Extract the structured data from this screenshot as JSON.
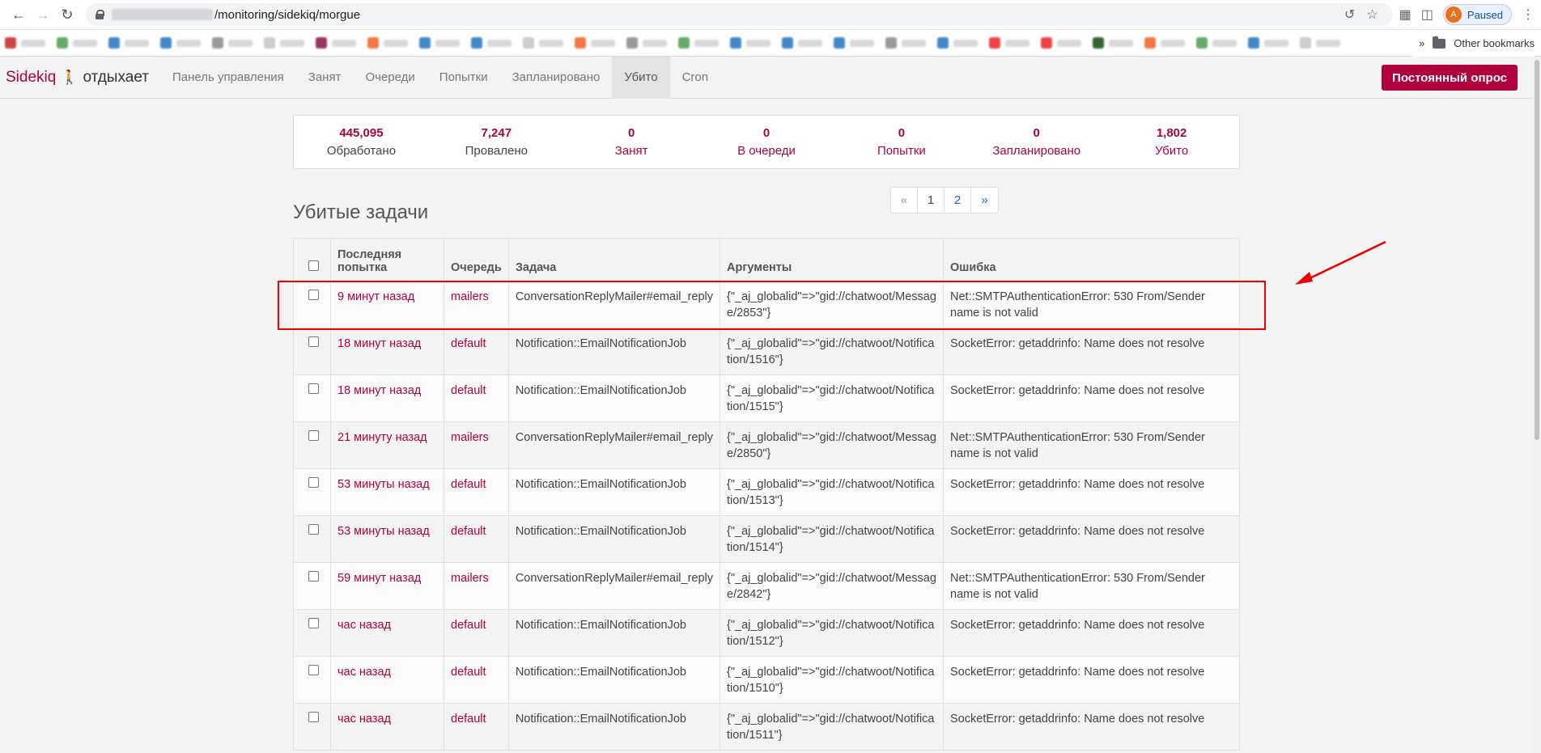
{
  "browser": {
    "url_path": "/monitoring/sidekiq/morgue",
    "profile_initial": "A",
    "profile_status": "Paused",
    "other_bookmarks": "Other bookmarks",
    "bookmarks_overflow": "»"
  },
  "navbar": {
    "brand_name": "Sidekiq",
    "brand_status": "отдыхает",
    "items": [
      {
        "label": "Панель управления"
      },
      {
        "label": "Занят"
      },
      {
        "label": "Очереди"
      },
      {
        "label": "Попытки"
      },
      {
        "label": "Запланировано"
      },
      {
        "label": "Убито",
        "active": true
      },
      {
        "label": "Cron"
      }
    ],
    "poll_button": "Постоянный опрос"
  },
  "summary": [
    {
      "value": "445,095",
      "label": "Обработано"
    },
    {
      "value": "7,247",
      "label": "Провалено"
    },
    {
      "value": "0",
      "label": "Занят"
    },
    {
      "value": "0",
      "label": "В очереди"
    },
    {
      "value": "0",
      "label": "Попытки"
    },
    {
      "value": "0",
      "label": "Запланировано"
    },
    {
      "value": "1,802",
      "label": "Убито"
    }
  ],
  "page_title": "Убитые задачи",
  "pagination": {
    "prev": "«",
    "pages": [
      "1",
      "2"
    ],
    "next": "»",
    "current": "1"
  },
  "table": {
    "headers": [
      "Последняя попытка",
      "Очередь",
      "Задача",
      "Аргументы",
      "Ошибка"
    ],
    "rows": [
      {
        "time": "9 минут назад",
        "queue": "mailers",
        "job": "ConversationReplyMailer#email_reply",
        "args": "{\"_aj_globalid\"=>\"gid://chatwoot/Message/2853\"}",
        "error": "Net::SMTPAuthenticationError: 530 From/Sender name is not valid"
      },
      {
        "time": "18 минут назад",
        "queue": "default",
        "job": "Notification::EmailNotificationJob",
        "args": "{\"_aj_globalid\"=>\"gid://chatwoot/Notification/1516\"}",
        "error": "SocketError: getaddrinfo: Name does not resolve"
      },
      {
        "time": "18 минут назад",
        "queue": "default",
        "job": "Notification::EmailNotificationJob",
        "args": "{\"_aj_globalid\"=>\"gid://chatwoot/Notification/1515\"}",
        "error": "SocketError: getaddrinfo: Name does not resolve"
      },
      {
        "time": "21 минуту назад",
        "queue": "mailers",
        "job": "ConversationReplyMailer#email_reply",
        "args": "{\"_aj_globalid\"=>\"gid://chatwoot/Message/2850\"}",
        "error": "Net::SMTPAuthenticationError: 530 From/Sender name is not valid"
      },
      {
        "time": "53 минуты назад",
        "queue": "default",
        "job": "Notification::EmailNotificationJob",
        "args": "{\"_aj_globalid\"=>\"gid://chatwoot/Notification/1513\"}",
        "error": "SocketError: getaddrinfo: Name does not resolve"
      },
      {
        "time": "53 минуты назад",
        "queue": "default",
        "job": "Notification::EmailNotificationJob",
        "args": "{\"_aj_globalid\"=>\"gid://chatwoot/Notification/1514\"}",
        "error": "SocketError: getaddrinfo: Name does not resolve"
      },
      {
        "time": "59 минут назад",
        "queue": "mailers",
        "job": "ConversationReplyMailer#email_reply",
        "args": "{\"_aj_globalid\"=>\"gid://chatwoot/Message/2842\"}",
        "error": "Net::SMTPAuthenticationError: 530 From/Sender name is not valid"
      },
      {
        "time": "час назад",
        "queue": "default",
        "job": "Notification::EmailNotificationJob",
        "args": "{\"_aj_globalid\"=>\"gid://chatwoot/Notification/1512\"}",
        "error": "SocketError: getaddrinfo: Name does not resolve"
      },
      {
        "time": "час назад",
        "queue": "default",
        "job": "Notification::EmailNotificationJob",
        "args": "{\"_aj_globalid\"=>\"gid://chatwoot/Notification/1510\"}",
        "error": "SocketError: getaddrinfo: Name does not resolve"
      },
      {
        "time": "час назад",
        "queue": "default",
        "job": "Notification::EmailNotificationJob",
        "args": "{\"_aj_globalid\"=>\"gid://chatwoot/Notification/1511\"}",
        "error": "SocketError: getaddrinfo: Name does not resolve"
      }
    ]
  },
  "colors": {
    "accent": "#b1003e",
    "annotation": "#ef0000"
  }
}
